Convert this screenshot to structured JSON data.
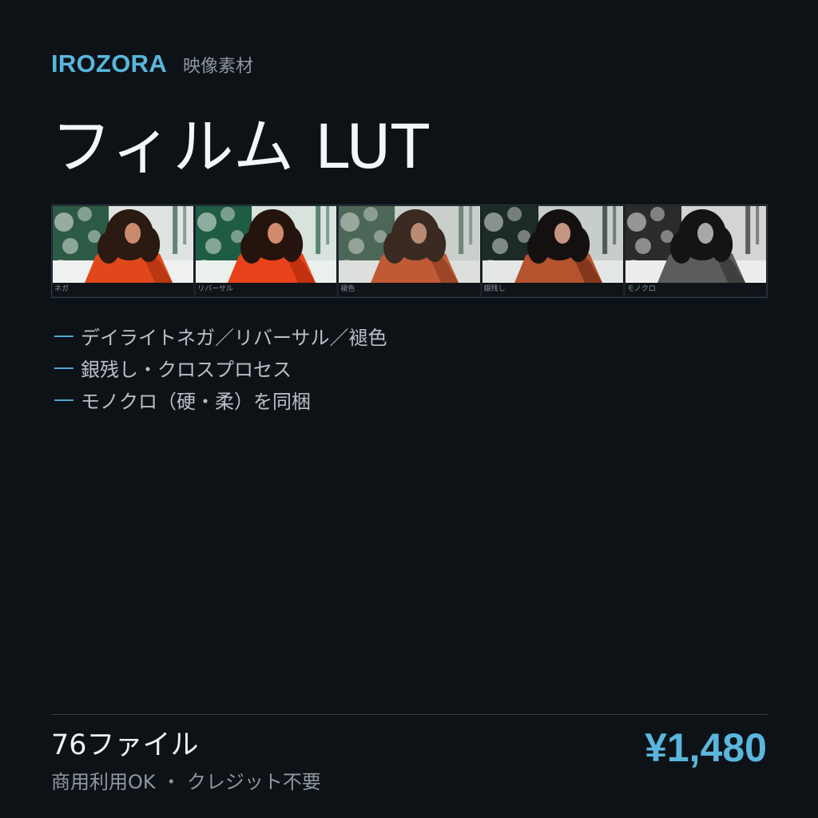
{
  "header": {
    "brand": "IROZORA",
    "category": "映像素材"
  },
  "product": {
    "title": "フィルム LUT"
  },
  "preview_strip": {
    "frames": [
      {
        "label": "ネガ"
      },
      {
        "label": "リバーサル"
      },
      {
        "label": "褪色"
      },
      {
        "label": "銀残し"
      },
      {
        "label": "モノクロ"
      }
    ]
  },
  "features": [
    "デイライトネガ／リバーサル／褪色",
    "銀残し・クロスプロセス",
    "モノクロ（硬・柔）を同梱"
  ],
  "footer": {
    "file_count": "76ファイル",
    "license": "商用利用OK ・ クレジット不要",
    "price": "¥1,480"
  },
  "colors": {
    "background": "#0d1217",
    "accent": "#5ab6dc"
  }
}
